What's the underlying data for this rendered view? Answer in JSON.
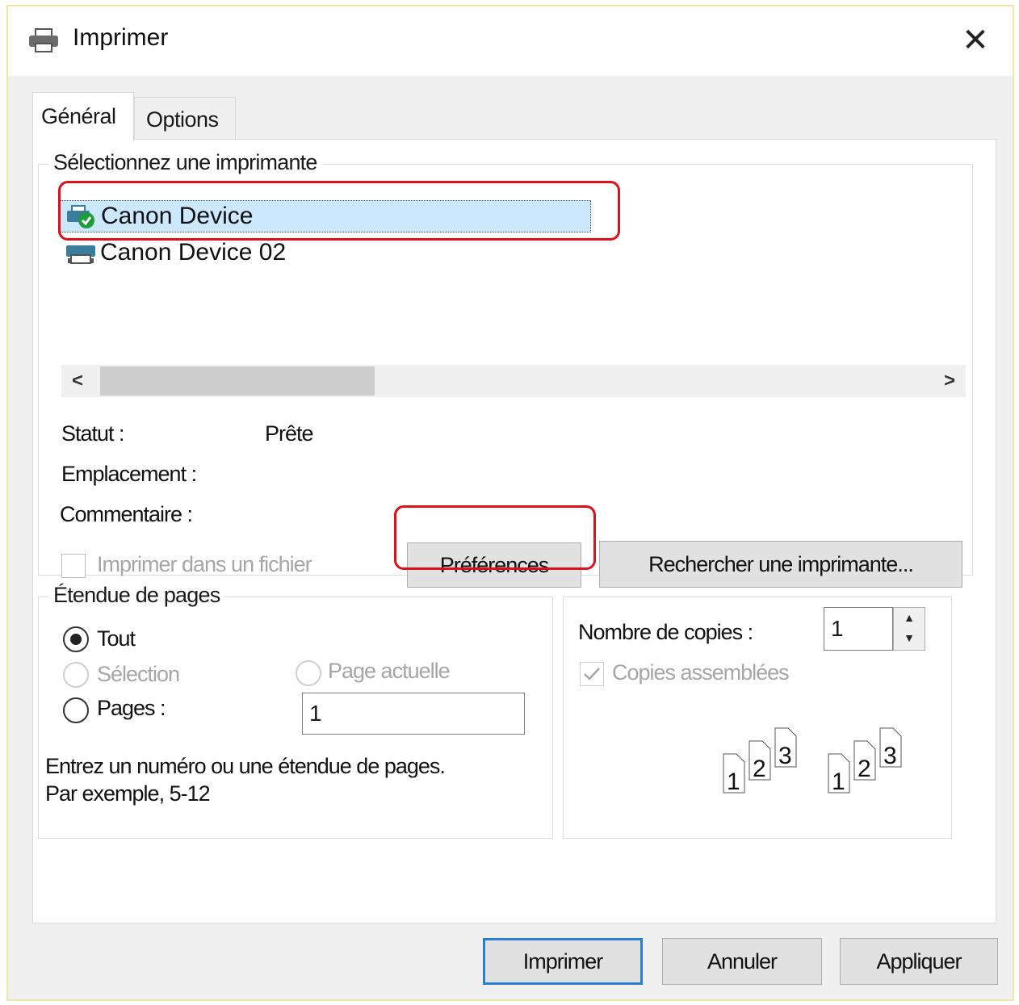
{
  "window": {
    "title": "Imprimer",
    "close_glyph": "✕"
  },
  "tabs": [
    {
      "label": "Général"
    },
    {
      "label": "Options"
    }
  ],
  "printer_group": {
    "legend": "Sélectionnez une imprimante",
    "printers": [
      {
        "name": "Canon Device",
        "icon": "printer-default-icon",
        "selected": true
      },
      {
        "name": "Canon Device 02",
        "icon": "printer-icon",
        "selected": false
      }
    ],
    "scroll_left": "<",
    "scroll_right": ">",
    "status_label": "Statut :",
    "status_value": "Prête",
    "location_label": "Emplacement :",
    "comment_label": "Commentaire :",
    "print_to_file_label": "Imprimer dans un fichier",
    "preferences_button": "Préférences",
    "find_printer_button": "Rechercher une imprimante..."
  },
  "page_range": {
    "legend": "Étendue de pages",
    "all_label": "Tout",
    "selection_label": "Sélection",
    "current_page_label": "Page actuelle",
    "pages_label": "Pages :",
    "pages_value": "1",
    "hint_line1": "Entrez un numéro ou une étendue de pages.",
    "hint_line2": "Par exemple, 5-12"
  },
  "copies": {
    "count_label": "Nombre de copies :",
    "count_value": "1",
    "collate_label": "Copies assemblées",
    "collate_checked": true,
    "page_numbers": [
      "1",
      "2",
      "3"
    ]
  },
  "footer": {
    "print_button": "Imprimer",
    "cancel_button": "Annuler",
    "apply_button": "Appliquer"
  },
  "colors": {
    "selection": "#cce8ff",
    "highlight": "#e0101a",
    "default_button": "#2a7fd4"
  }
}
